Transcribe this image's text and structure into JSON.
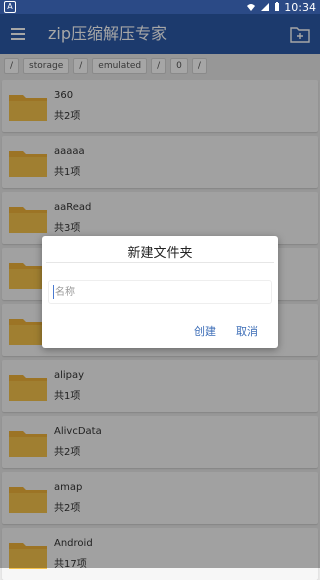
{
  "status": {
    "time": "10:34",
    "left_icon_label": "A"
  },
  "appbar": {
    "title": "zip压缩解压专家",
    "menu_icon": "menu-icon",
    "new_folder_icon": "new-folder-icon"
  },
  "breadcrumbs": [
    "/",
    "storage",
    "/",
    "emulated",
    "/",
    "0",
    "/"
  ],
  "folders": [
    {
      "name": "360",
      "count": "共2项"
    },
    {
      "name": "aaaaa",
      "count": "共1项"
    },
    {
      "name": "aaRead",
      "count": "共3项"
    },
    {
      "name": "",
      "count": ""
    },
    {
      "name": "",
      "count": ""
    },
    {
      "name": "alipay",
      "count": "共1项"
    },
    {
      "name": "AlivcData",
      "count": "共2项"
    },
    {
      "name": "amap",
      "count": "共2项"
    },
    {
      "name": "Android",
      "count": "共17项"
    }
  ],
  "dialog": {
    "title": "新建文件夹",
    "input_placeholder": "名称",
    "input_value": "",
    "create_label": "创建",
    "cancel_label": "取消"
  },
  "colors": {
    "statusbar": "#2b4a86",
    "appbar": "#2b5aa8",
    "folder": "#f0b23a",
    "accent": "#3c6db7"
  }
}
